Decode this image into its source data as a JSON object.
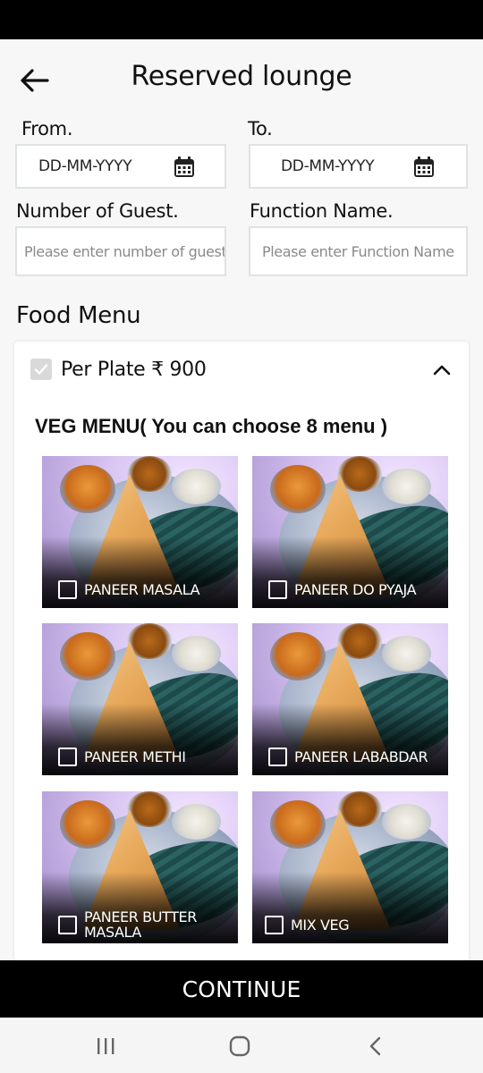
{
  "header": {
    "title": "Reserved lounge",
    "back_icon": "arrow-left-icon"
  },
  "form": {
    "from_label": "From.",
    "to_label": "To.",
    "from_value": "DD-MM-YYYY",
    "to_value": "DD-MM-YYYY",
    "guests_label": "Number of Guest.",
    "guests_placeholder": "Please enter number of guest",
    "function_label": "Function Name.",
    "function_placeholder": "Please enter Function Name"
  },
  "food_menu": {
    "title": "Food Menu",
    "per_plate_label": "Per Plate ₹ 900",
    "per_plate_checked": true,
    "veg_heading": "VEG MENU( You can choose 8 menu )",
    "items": [
      {
        "name": "PANEER MASALA",
        "checked": false
      },
      {
        "name": "PANEER DO PYAJA",
        "checked": false
      },
      {
        "name": "PANEER METHI",
        "checked": false
      },
      {
        "name": "PANEER LABABDAR",
        "checked": false
      },
      {
        "name": "PANEER BUTTER MASALA",
        "checked": false
      },
      {
        "name": "MIX VEG",
        "checked": false
      }
    ]
  },
  "footer": {
    "continue_label": "CONTINUE"
  },
  "system_nav": {
    "icons": [
      "recent-apps-icon",
      "home-icon",
      "back-icon"
    ]
  },
  "colors": {
    "background": "#f7f7f7",
    "accent": "#000000",
    "field_border": "#dfe3e3"
  }
}
